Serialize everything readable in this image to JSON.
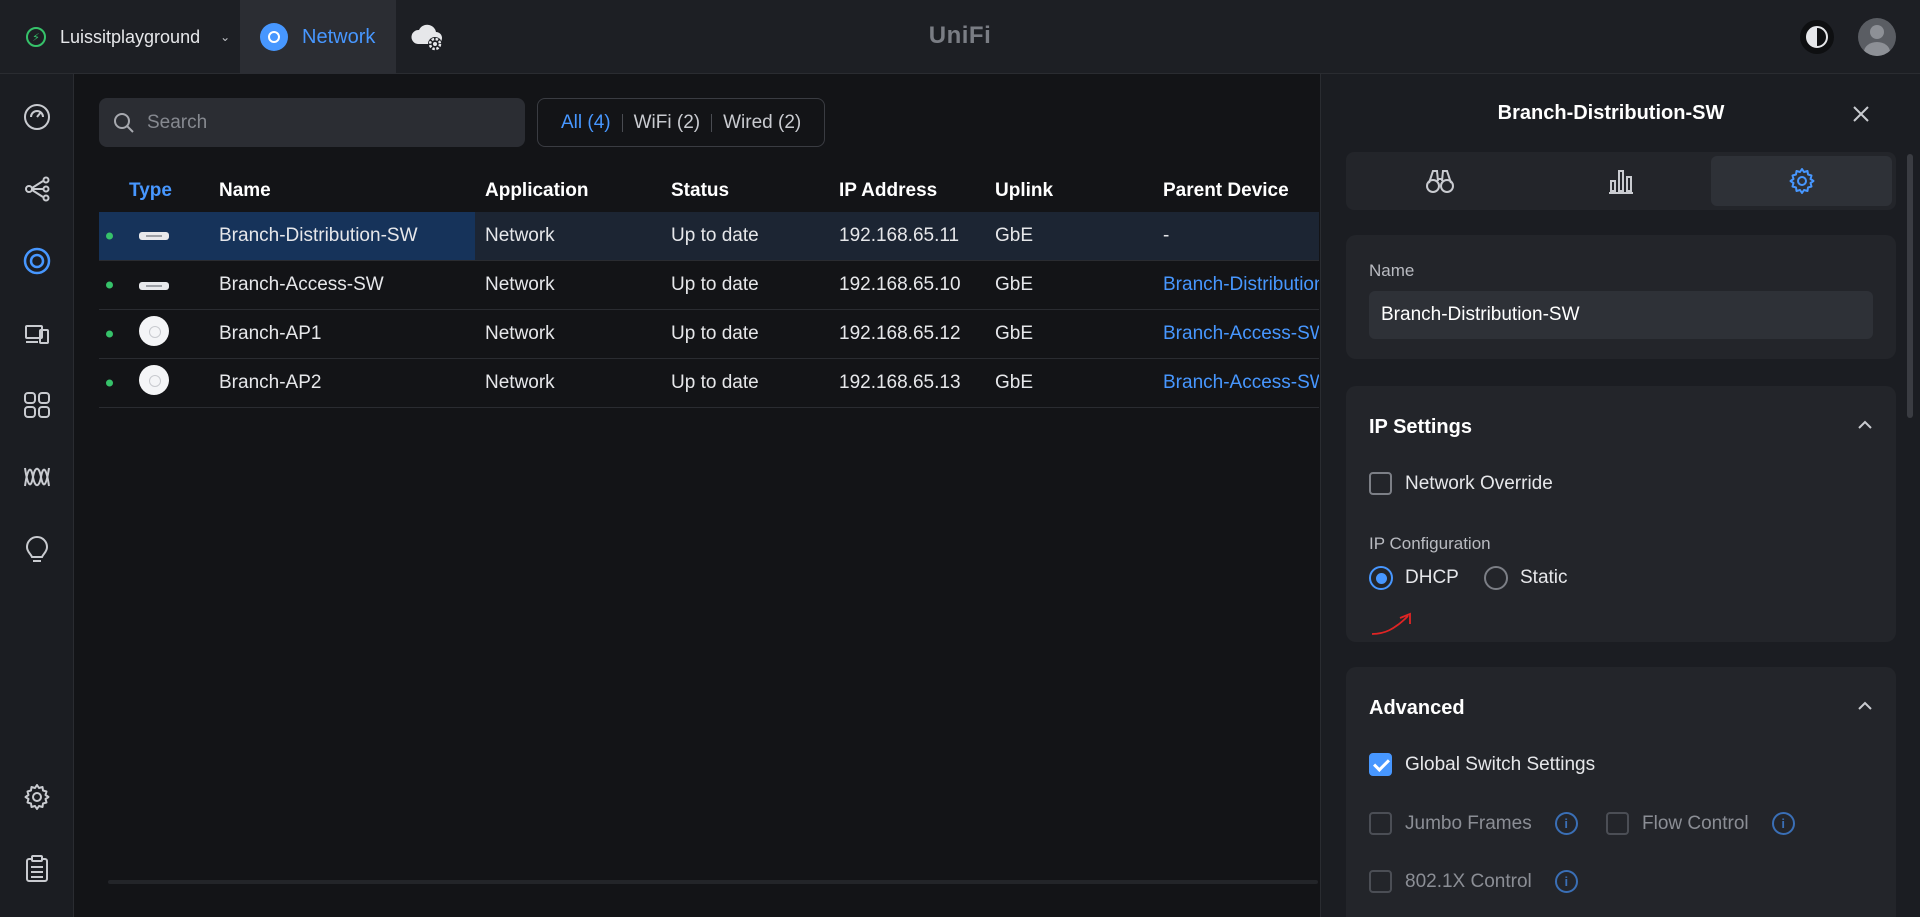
{
  "topbar": {
    "site_name": "Luissitplayground",
    "app_tab": "Network",
    "brand": "UniFi"
  },
  "sidebar": {
    "items": [
      "dashboard-icon",
      "topology-icon",
      "devices-icon",
      "clients-icon",
      "ports-icon",
      "insights-icon",
      "alarm-icon",
      "settings-icon",
      "logs-icon"
    ],
    "active": "devices-icon"
  },
  "search": {
    "placeholder": "Search",
    "value": ""
  },
  "filters": [
    {
      "label": "All (4)",
      "active": true
    },
    {
      "label": "WiFi (2)",
      "active": false
    },
    {
      "label": "Wired (2)",
      "active": false
    }
  ],
  "table": {
    "columns": [
      "Type",
      "Name",
      "Application",
      "Status",
      "IP Address",
      "Uplink",
      "Parent Device"
    ],
    "rows": [
      {
        "type": "switch",
        "name": "Branch-Distribution-SW",
        "application": "Network",
        "status": "Up to date",
        "ip": "192.168.65.11",
        "uplink": "GbE",
        "parent": "-",
        "parent_link": false,
        "selected": true
      },
      {
        "type": "switch",
        "name": "Branch-Access-SW",
        "application": "Network",
        "status": "Up to date",
        "ip": "192.168.65.10",
        "uplink": "GbE",
        "parent": "Branch-Distribution",
        "parent_link": true,
        "selected": false
      },
      {
        "type": "ap",
        "name": "Branch-AP1",
        "application": "Network",
        "status": "Up to date",
        "ip": "192.168.65.12",
        "uplink": "GbE",
        "parent": "Branch-Access-SW",
        "parent_link": true,
        "selected": false
      },
      {
        "type": "ap",
        "name": "Branch-AP2",
        "application": "Network",
        "status": "Up to date",
        "ip": "192.168.65.13",
        "uplink": "GbE",
        "parent": "Branch-Access-SW",
        "parent_link": true,
        "selected": false
      }
    ]
  },
  "panel": {
    "title": "Branch-Distribution-SW",
    "tabs": [
      "binoculars-icon",
      "bar-chart-icon",
      "gear-icon"
    ],
    "active_tab": "gear-icon",
    "name_label": "Name",
    "name_value": "Branch-Distribution-SW",
    "ip_settings": {
      "title": "IP Settings",
      "network_override": "Network Override",
      "network_override_checked": false,
      "config_label": "IP Configuration",
      "dhcp": "DHCP",
      "static": "Static",
      "selected": "DHCP"
    },
    "advanced": {
      "title": "Advanced",
      "global_switch": "Global Switch Settings",
      "global_switch_checked": true,
      "jumbo": "Jumbo Frames",
      "flow": "Flow Control",
      "dot1x": "802.1X Control"
    }
  },
  "colors": {
    "accent": "#4797ff",
    "online": "#36c26a",
    "annotation": "#e02424"
  }
}
